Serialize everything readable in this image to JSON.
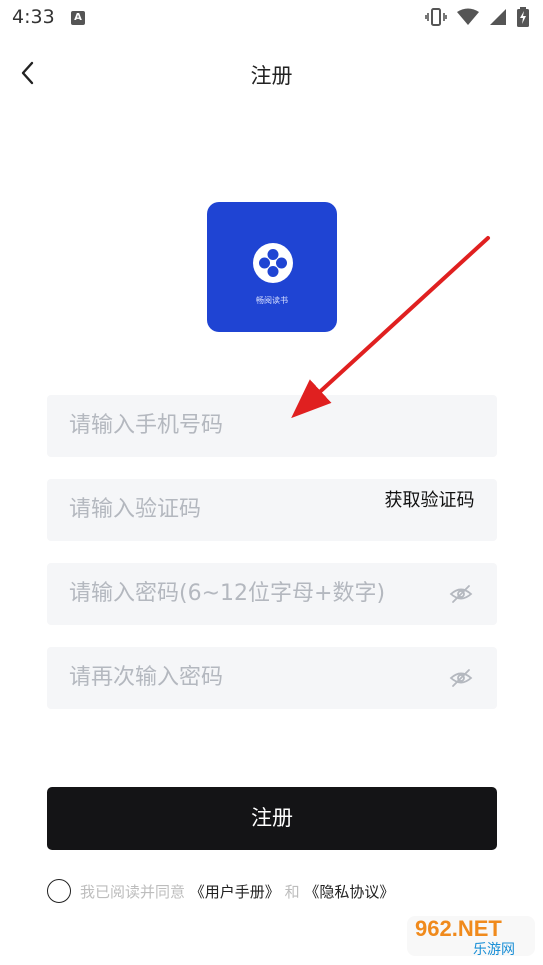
{
  "status_bar": {
    "time": "4:33",
    "notification_badge": "A"
  },
  "header": {
    "title": "注册"
  },
  "logo": {
    "text": "畅阅读书"
  },
  "form": {
    "phone_placeholder": "请输入手机号码",
    "code_placeholder": "请输入验证码",
    "get_code_label": "获取验证码",
    "password_placeholder": "请输入密码(6~12位字母+数字)",
    "confirm_placeholder": "请再次输入密码"
  },
  "submit_label": "注册",
  "agreement": {
    "prefix": "我已阅读并同意",
    "user_manual": "《用户手册》",
    "and": "和",
    "privacy": "《隐私协议》"
  },
  "watermark": {
    "top": "962.NET",
    "bottom": "乐游网"
  },
  "colors": {
    "logo_bg": "#1f44d3",
    "button_bg": "#141416",
    "field_bg": "#f5f6f8",
    "annotation_arrow": "#e02020"
  }
}
